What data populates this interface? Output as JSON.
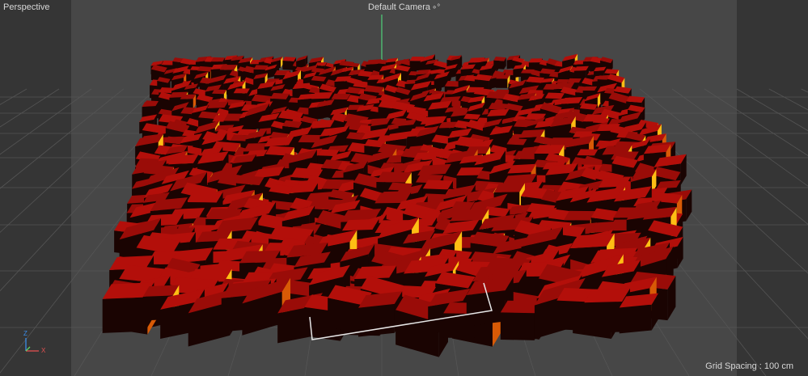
{
  "viewport": {
    "view_name": "Perspective",
    "camera_name": "Default Camera",
    "camera_icon": "camera-link-icon",
    "grid_spacing": "Grid Spacing : 100 cm"
  },
  "axis_gizmo": {
    "z_label": "Z",
    "x_label": "X",
    "z_color": "#3b8eea",
    "x_color": "#e25050",
    "y_color": "#60d060"
  },
  "colors": {
    "background": "#474747",
    "frame_overlay": "#353535",
    "grid_line": "#555555",
    "cube_face_red": "#b30f0a",
    "cube_face_dark": "#1a0402",
    "cube_highlight": "#ffbe14",
    "cube_mid": "#d85a06",
    "selection_bracket": "#e6e6e6",
    "y_axis_line": "#4fd07a"
  },
  "scene": {
    "object": "cloner-cube-field"
  }
}
